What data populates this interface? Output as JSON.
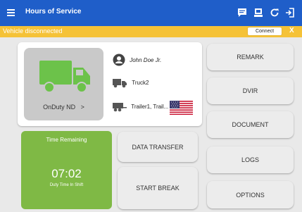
{
  "appbar": {
    "title": "Hours of Service"
  },
  "banner": {
    "message": "Vehicle disconnected",
    "connect_label": "Connect",
    "close_label": "X"
  },
  "driver": {
    "name": "John Doe Jr.",
    "truck": "Truck2",
    "trailer": "Trailer1, Trail...",
    "status": "OnDuty ND",
    "status_chevron": ">"
  },
  "timer": {
    "label": "Time Remaining",
    "value": "07:02",
    "sublabel": "Duty Time In Shift"
  },
  "actions": {
    "data_transfer": "DATA TRANSFER",
    "start_break": "START BREAK",
    "remark": "REMARK",
    "dvir": "DVIR",
    "document": "DOCUMENT",
    "logs": "LOGS",
    "options": "OPTIONS"
  },
  "colors": {
    "appbar": "#1f5ec9",
    "banner": "#f5c237",
    "truck": "#6cc24a",
    "timer": "#7fb945"
  },
  "icons": [
    "menu-icon",
    "message-icon",
    "device-icon",
    "refresh-icon",
    "logout-icon",
    "truck-icon",
    "user-icon",
    "trailer-icon",
    "us-flag-icon"
  ]
}
